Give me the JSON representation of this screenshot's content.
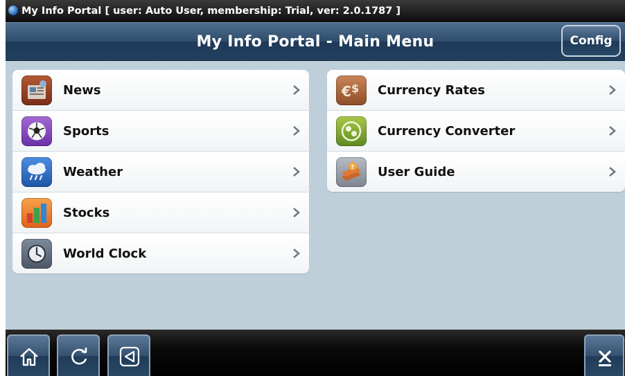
{
  "window": {
    "title": "My Info Portal [ user: Auto User, membership: Trial, ver: 2.0.1787 ]"
  },
  "header": {
    "title": "My Info Portal - Main Menu",
    "config_label": "Config"
  },
  "menu_left": [
    {
      "label": "News",
      "icon": "news-icon"
    },
    {
      "label": "Sports",
      "icon": "soccer-ball-icon"
    },
    {
      "label": "Weather",
      "icon": "weather-cloud-icon"
    },
    {
      "label": "Stocks",
      "icon": "stocks-chart-icon"
    },
    {
      "label": "World Clock",
      "icon": "clock-icon"
    }
  ],
  "menu_right": [
    {
      "label": "Currency Rates",
      "icon": "currency-icon"
    },
    {
      "label": "Currency Converter",
      "icon": "currency-converter-icon"
    },
    {
      "label": "User Guide",
      "icon": "user-guide-book-icon"
    }
  ],
  "toolbar": {
    "buttons": [
      "home-icon",
      "refresh-icon",
      "back-icon",
      "close-icon"
    ]
  },
  "colors": {
    "header": "#2e4c6b",
    "content_bg": "#bfcfd9",
    "toolbar": "#000000"
  }
}
